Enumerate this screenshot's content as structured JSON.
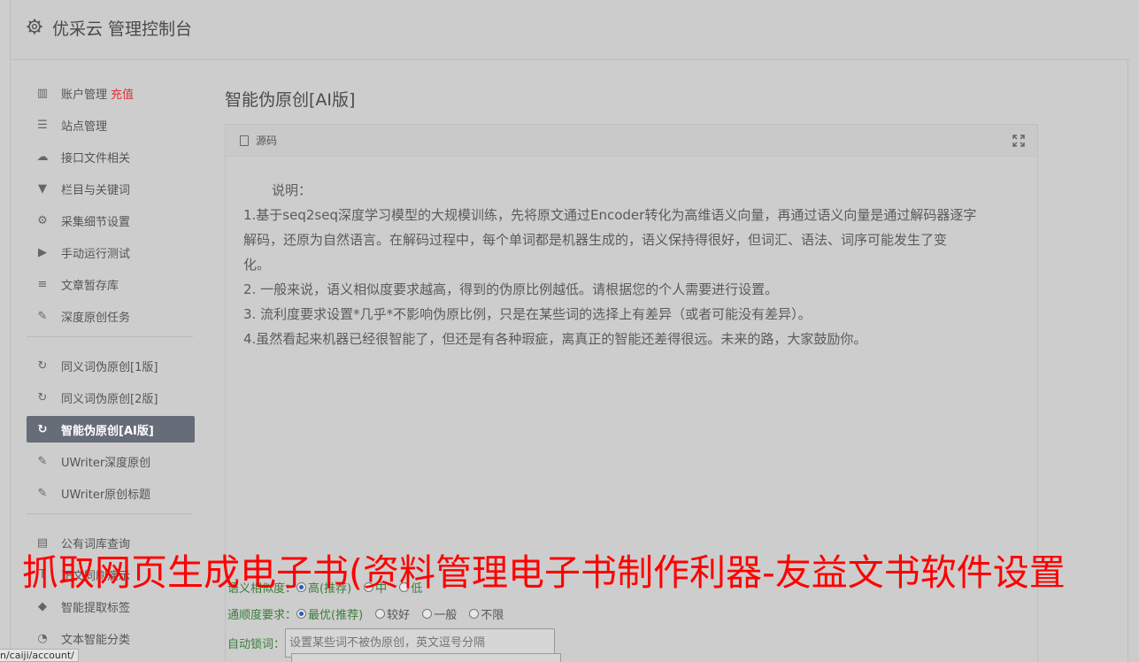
{
  "header": {
    "title": "优采云 管理控制台",
    "icon": "gear-icon"
  },
  "sidebar": {
    "group1": [
      {
        "label": "账户管理",
        "badge": "充值",
        "icon": "bar-chart-icon"
      },
      {
        "label": "站点管理",
        "icon": "server-icon"
      },
      {
        "label": "接口文件相关",
        "icon": "cloud-upload-icon"
      },
      {
        "label": "栏目与关键词",
        "icon": "filter-icon"
      },
      {
        "label": "采集细节设置",
        "icon": "gears-icon"
      },
      {
        "label": "手动运行测试",
        "icon": "play-circle-icon"
      },
      {
        "label": "文章暂存库",
        "icon": "database-icon"
      },
      {
        "label": "深度原创任务",
        "icon": "edit-icon"
      }
    ],
    "group2": [
      {
        "label": "同义词伪原创[1版]",
        "icon": "refresh-icon"
      },
      {
        "label": "同义词伪原创[2版]",
        "icon": "refresh-icon"
      },
      {
        "label": "智能伪原创[AI版]",
        "icon": "refresh-icon",
        "active": true
      },
      {
        "label": "UWriter深度原创",
        "icon": "edit-icon"
      },
      {
        "label": "UWriter原创标题",
        "icon": "edit-icon"
      }
    ],
    "group3": [
      {
        "label": "公有词库查询",
        "icon": "book-icon"
      },
      {
        "label": "正文同刷演示",
        "icon": "text-icon"
      },
      {
        "label": "智能提取标签",
        "icon": "tag-icon"
      },
      {
        "label": "文本智能分类",
        "icon": "pie-chart-icon"
      }
    ]
  },
  "main": {
    "title": "智能伪原创[AI版]",
    "panel_title": "源码",
    "description": [
      "说明：",
      "1.基于seq2seq深度学习模型的大规模训练，先将原文通过Encoder转化为高维语义向量，再通过语义向量是通过解码器逐字",
      "解码，还原为自然语言。在解码过程中，每个单词都是机器生成的，语义保持得很好，但词汇、语法、词序可能发生了变",
      "化。",
      "2. 一般来说，语义相似度要求越高，得到的伪原比例越低。请根据您的个人需要进行设置。",
      "3. 流利度要求设置*几乎*不影响伪原比例，只是在某些词的选择上有差异（或者可能没有差异）。",
      "4.虽然看起来机器已经很智能了，但还是有各种瑕疵，离真正的智能还差得很远。未来的路，大家鼓励你。"
    ]
  },
  "form": {
    "similarity_label": "语义相似度：",
    "similarity_options": [
      "高(推荐)",
      "中",
      "低"
    ],
    "fluency_label": "通顺度要求：",
    "fluency_options": [
      "最优(推荐)",
      "较好",
      "一般",
      "不限"
    ],
    "lock_label": "自动锁词：",
    "lock_placeholder": "设置某些词不被伪原创，英文逗号分隔"
  },
  "watermark": "抓取网页生成电子书(资料管理电子书制作利器-友益文书软件设置",
  "statusbar": "n/caiji/account/"
}
